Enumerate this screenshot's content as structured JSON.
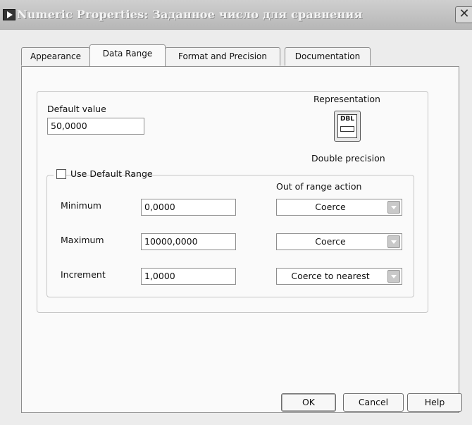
{
  "window": {
    "title": "Numeric Properties: Заданное число для сравнения",
    "close_glyph": "✕",
    "app_icon": "labview-vi-icon"
  },
  "tabs": [
    {
      "label": "Appearance",
      "active": false
    },
    {
      "label": "Data Range",
      "active": true
    },
    {
      "label": "Format and Precision",
      "active": false
    },
    {
      "label": "Documentation",
      "active": false
    }
  ],
  "data_range": {
    "default_value_label": "Default value",
    "default_value": "50,0000",
    "representation_label": "Representation",
    "representation_badge": "DBL",
    "representation_name": "Double precision",
    "use_default_range": {
      "label": "Use Default Range",
      "checked": false
    },
    "out_of_range_header": "Out of range action",
    "rows": [
      {
        "label": "Minimum",
        "value": "0,0000",
        "action": "Coerce"
      },
      {
        "label": "Maximum",
        "value": "10000,0000",
        "action": "Coerce"
      },
      {
        "label": "Increment",
        "value": "1,0000",
        "action": "Coerce to nearest"
      }
    ]
  },
  "buttons": {
    "ok": "OK",
    "cancel": "Cancel",
    "help": "Help"
  }
}
